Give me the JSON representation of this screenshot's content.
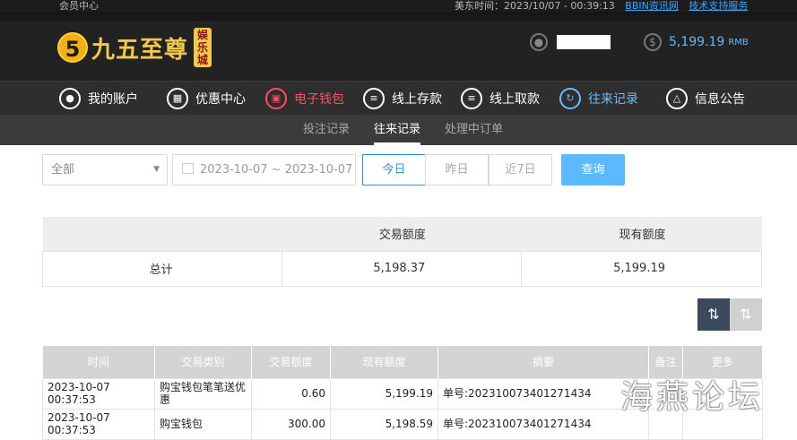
{
  "topbar": {
    "left": "会员中心",
    "time": "美东时间：2023/10/07 - 00:39:13",
    "link1": "BBIN资讯网",
    "link2": "技术支持服务"
  },
  "header": {
    "logo_mark": "5",
    "logo_text": "九五至尊",
    "logo_badge": "娱乐城",
    "user_icon": "user-icon",
    "currency_icon": "dollar-icon",
    "balance": "5,199.19",
    "balance_unit": "RMB"
  },
  "nav": [
    {
      "label": "我的账户",
      "icon": "user-icon"
    },
    {
      "label": "优惠中心",
      "icon": "gift-icon"
    },
    {
      "label": "电子钱包",
      "icon": "wallet-icon"
    },
    {
      "label": "线上存款",
      "icon": "deposit-icon"
    },
    {
      "label": "线上取款",
      "icon": "withdraw-icon"
    },
    {
      "label": "往来记录",
      "icon": "records-icon"
    },
    {
      "label": "信息公告",
      "icon": "bell-icon"
    }
  ],
  "subnav": [
    "投注记录",
    "往来记录",
    "处理中订单"
  ],
  "filters": {
    "select": "全部",
    "date_range": "2023-10-07 ~ 2023-10-07",
    "today": "今日",
    "yesterday": "昨日",
    "last7": "近7日",
    "query": "查询"
  },
  "summary": {
    "headers": [
      "",
      "交易额度",
      "现有额度"
    ],
    "label": "总计",
    "trade": "5,198.37",
    "current": "5,199.19"
  },
  "records": {
    "headers": [
      "时间",
      "交易类别",
      "交易额度",
      "现有额度",
      "摘要",
      "备注",
      "更多"
    ],
    "rows": [
      {
        "time": "2023-10-07 00:37:53",
        "type": "购宝钱包笔笔送优惠",
        "amount": "0.60",
        "balance": "5,199.19",
        "summary": "单号:202310073401271434"
      },
      {
        "time": "2023-10-07 00:37:53",
        "type": "购宝钱包",
        "amount": "300.00",
        "balance": "5,198.59",
        "summary": "单号:202310073401271434"
      }
    ]
  },
  "watermark": "海燕论坛",
  "colors": {
    "accent": "#5cb8ff",
    "active_red": "#ff4d61",
    "active_blue": "#6bbcff",
    "gold": "#f3c94a"
  }
}
